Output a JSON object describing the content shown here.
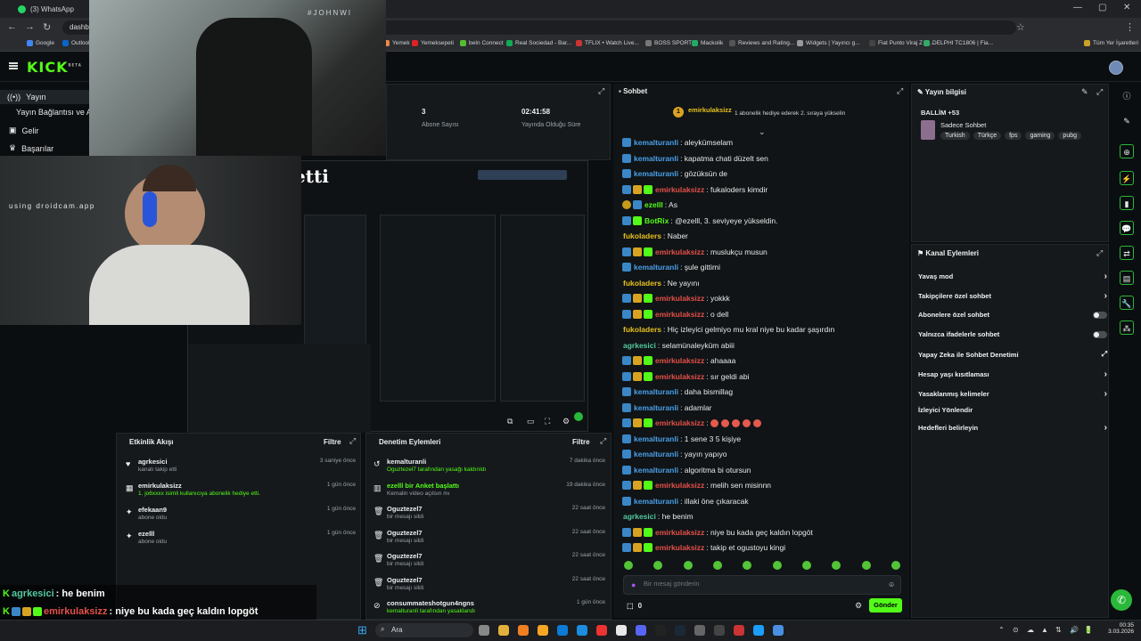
{
  "browser": {
    "tab_title": "(3) WhatsApp",
    "url": "dashbo",
    "bookmarks": [
      "Google",
      "Outlook",
      "Yemek",
      "Yemeksepeti",
      "beIn Connect",
      "Real Sociedad - Bar...",
      "TFLIX • Watch Live...",
      "BOSS SPORT",
      "Mackolik",
      "Reviews and Rating...",
      "Widgets | Yayıncı g...",
      "Fiat Punto Viraj Z R...",
      "DELPHI TC1806 | Fia..."
    ],
    "all_bookmarks": "Tüm Yer İşaretleri"
  },
  "header": {
    "logo": "KICK",
    "logo_sup": "BETA"
  },
  "sidebar": {
    "items": [
      "Yayın",
      "Yayın Bağlantısı ve Ar",
      "Gelir",
      "Başarılar"
    ]
  },
  "overlay": {
    "hashtag": "#JOHNWI",
    "droidcam": "using droidcam.app",
    "title_fragment": "etti"
  },
  "stats": [
    {
      "value": "3",
      "label": "Abone Sayısı"
    },
    {
      "value": "02:41:58",
      "label": "Yayında Olduğu Süre"
    }
  ],
  "chat": {
    "title": "Sohbet",
    "pinned_user": "emirkulaksizz",
    "pinned_level": "1",
    "pinned_note": "1 abonelik hediye ederek 2. sıraya yükselin",
    "messages": [
      {
        "user": "kemalturanli",
        "color": "#4a9fe8",
        "badges": [
          "blue"
        ],
        "text": ": aleykümselam"
      },
      {
        "user": "kemalturanli",
        "color": "#4a9fe8",
        "badges": [
          "blue"
        ],
        "text": ": kapatma chati düzelt sen"
      },
      {
        "user": "kemalturanli",
        "color": "#4a9fe8",
        "badges": [
          "blue"
        ],
        "text": ": gözüksün de"
      },
      {
        "user": "emirkulaksizz",
        "color": "#e4504a",
        "badges": [
          "blue",
          "gold",
          "green"
        ],
        "text": ": fukaloders kimdir"
      },
      {
        "user": "ezelll",
        "color": "#53fc18",
        "badges": [
          "circ",
          "blue"
        ],
        "text": ": As"
      },
      {
        "user": "BotRix",
        "color": "#53fc18",
        "badges": [
          "blue",
          "green"
        ],
        "text": ": @ezelll, 3. seviyeye yükseldin."
      },
      {
        "user": "fukoladers",
        "color": "#e7c01f",
        "badges": [],
        "text": ": Naber"
      },
      {
        "user": "emirkulaksizz",
        "color": "#e4504a",
        "badges": [
          "blue",
          "gold",
          "green"
        ],
        "text": ": muslukçu musun"
      },
      {
        "user": "kemalturanli",
        "color": "#4a9fe8",
        "badges": [
          "blue"
        ],
        "text": ": şule gittimi"
      },
      {
        "user": "fukoladers",
        "color": "#e7c01f",
        "badges": [],
        "text": ": Ne yayını"
      },
      {
        "user": "emirkulaksizz",
        "color": "#e4504a",
        "badges": [
          "blue",
          "gold",
          "green"
        ],
        "text": ": yokkk"
      },
      {
        "user": "emirkulaksizz",
        "color": "#e4504a",
        "badges": [
          "blue",
          "gold",
          "green"
        ],
        "text": ": o dell"
      },
      {
        "user": "fukoladers",
        "color": "#e7c01f",
        "badges": [],
        "text": ": Hiç izleyici gelmiyo mu kral niye bu kadar şaşırdın"
      },
      {
        "user": "agrkesici",
        "color": "#53c9a0",
        "badges": [],
        "text": ": selamünaleyküm abiii"
      },
      {
        "user": "emirkulaksizz",
        "color": "#e4504a",
        "badges": [
          "blue",
          "gold",
          "green"
        ],
        "text": ": ahaaaa"
      },
      {
        "user": "emirkulaksizz",
        "color": "#e4504a",
        "badges": [
          "blue",
          "gold",
          "green"
        ],
        "text": ": sır geldi abi"
      },
      {
        "user": "kemalturanli",
        "color": "#4a9fe8",
        "badges": [
          "blue"
        ],
        "text": ": daha bismillag"
      },
      {
        "user": "kemalturanli",
        "color": "#4a9fe8",
        "badges": [
          "blue"
        ],
        "text": ": adamlar"
      },
      {
        "user": "emirkulaksizz",
        "color": "#e4504a",
        "badges": [
          "blue",
          "gold",
          "green"
        ],
        "text": ":",
        "emotes": 5
      },
      {
        "user": "kemalturanli",
        "color": "#4a9fe8",
        "badges": [
          "blue"
        ],
        "text": ": 1 sene 3 5 kişiye"
      },
      {
        "user": "kemalturanli",
        "color": "#4a9fe8",
        "badges": [
          "blue"
        ],
        "text": ": yayın yapıyo"
      },
      {
        "user": "kemalturanli",
        "color": "#4a9fe8",
        "badges": [
          "blue"
        ],
        "text": ": algoritma bi otursun"
      },
      {
        "user": "emirkulaksizz",
        "color": "#e4504a",
        "badges": [
          "blue",
          "gold",
          "green"
        ],
        "text": ": melih sen misinnn"
      },
      {
        "user": "kemalturanli",
        "color": "#4a9fe8",
        "badges": [
          "blue"
        ],
        "text": ": illaki öne çıkaracak"
      },
      {
        "user": "agrkesici",
        "color": "#53c9a0",
        "badges": [],
        "text": ": he benim"
      },
      {
        "user": "emirkulaksizz",
        "color": "#e4504a",
        "badges": [
          "blue",
          "gold",
          "green"
        ],
        "text": ": niye bu kada geç kaldın lopgöt"
      },
      {
        "user": "emirkulaksizz",
        "color": "#e4504a",
        "badges": [
          "blue",
          "gold",
          "green"
        ],
        "text": ": takip et ogustoyu kingi"
      }
    ],
    "input_placeholder": "Bir mesaj gönderin",
    "points": "0",
    "send_label": "Gönder"
  },
  "stream_info": {
    "title": "Yayın bilgisi",
    "stream_title": "BALLİM +53",
    "category": "Sadece Sohbet",
    "tags": [
      "Turkish",
      "Türkçe",
      "fps",
      "gaming",
      "pubg"
    ]
  },
  "channel_actions": {
    "title": "Kanal Eylemleri",
    "items": [
      {
        "label": "Yavaş mod",
        "control": "chevron"
      },
      {
        "label": "Takipçilere özel sohbet",
        "control": "chevron"
      },
      {
        "label": "Abonelere özel sohbet",
        "control": "toggle"
      },
      {
        "label": "Yalnızca ifadelerle sohbet",
        "control": "toggle"
      },
      {
        "label": "Yapay Zeka ile Sohbet Denetimi",
        "control": "external"
      },
      {
        "label": "Hesap yaşı kısıtlaması",
        "control": "chevron"
      },
      {
        "label": "Yasaklanmış kelimeler",
        "control": "chevron"
      },
      {
        "label": "İzleyici Yönlendir",
        "control": "none"
      },
      {
        "label": "Hedefleri belirleyin",
        "control": "chevron"
      }
    ]
  },
  "activity_feed": {
    "title": "Etkinlik Akışı",
    "filter": "Filtre",
    "items": [
      {
        "name": "agrkesici",
        "sub": "kanalı takip etti",
        "time": "3 saniye önce",
        "icon": "heart-icon"
      },
      {
        "name": "emirkulaksizz",
        "sub": "1. jo6xxxx isimli kullanıcıya abonelik hediye etti.",
        "time": "1 gün önce",
        "icon": "gift-icon"
      },
      {
        "name": "efekaan9",
        "sub": "abone oldu",
        "time": "1 gün önce",
        "icon": "star-icon"
      },
      {
        "name": "ezelll",
        "sub": "abone oldu",
        "time": "1 gün önce",
        "icon": "star-icon"
      }
    ]
  },
  "moderation": {
    "title": "Denetim Eylemleri",
    "filter": "Filtre",
    "items": [
      {
        "name": "kemalturanli",
        "sub": "Oguztezel7 tarafından yasağı kaldırıldı",
        "time": "7 dakika önce",
        "icon": "undo-icon"
      },
      {
        "name": "ezelll bir Anket başlattı",
        "sub": "Kemalin video açılsın mı",
        "time": "19 dakika önce",
        "icon": "poll-icon"
      },
      {
        "name": "Oguztezel7",
        "sub": "bir mesajı sildi",
        "time": "22 saat önce",
        "icon": "trash-icon"
      },
      {
        "name": "Oguztezel7",
        "sub": "bir mesajı sildi",
        "time": "22 saat önce",
        "icon": "trash-icon"
      },
      {
        "name": "Oguztezel7",
        "sub": "bir mesajı sildi",
        "time": "22 saat önce",
        "icon": "trash-icon"
      },
      {
        "name": "Oguztezel7",
        "sub": "bir mesajı sildi",
        "time": "22 saat önce",
        "icon": "trash-icon"
      },
      {
        "name": "consummateshotgun4ngns",
        "sub": "kemalturanli tarafından yasaklandı",
        "time": "1 gün önce",
        "icon": "ban-icon"
      }
    ]
  },
  "overlay_chat": [
    {
      "user": "agrkesici",
      "color": "#53c9a0",
      "text": " : he benim"
    },
    {
      "user": "emirkulaksizz",
      "color": "#e4504a",
      "text": " : niye bu kada geç kaldın lopgöt"
    },
    {
      "user": "emirkulaksizz",
      "color": "#e4504a",
      "text": " : takip et ogustoyu kingi"
    }
  ],
  "taskbar": {
    "search": "Ara",
    "time": "00:35",
    "date": "3.03.2026"
  },
  "colors": {
    "accent": "#53fc18",
    "panel": "#15191c",
    "background": "#0b0e10"
  }
}
